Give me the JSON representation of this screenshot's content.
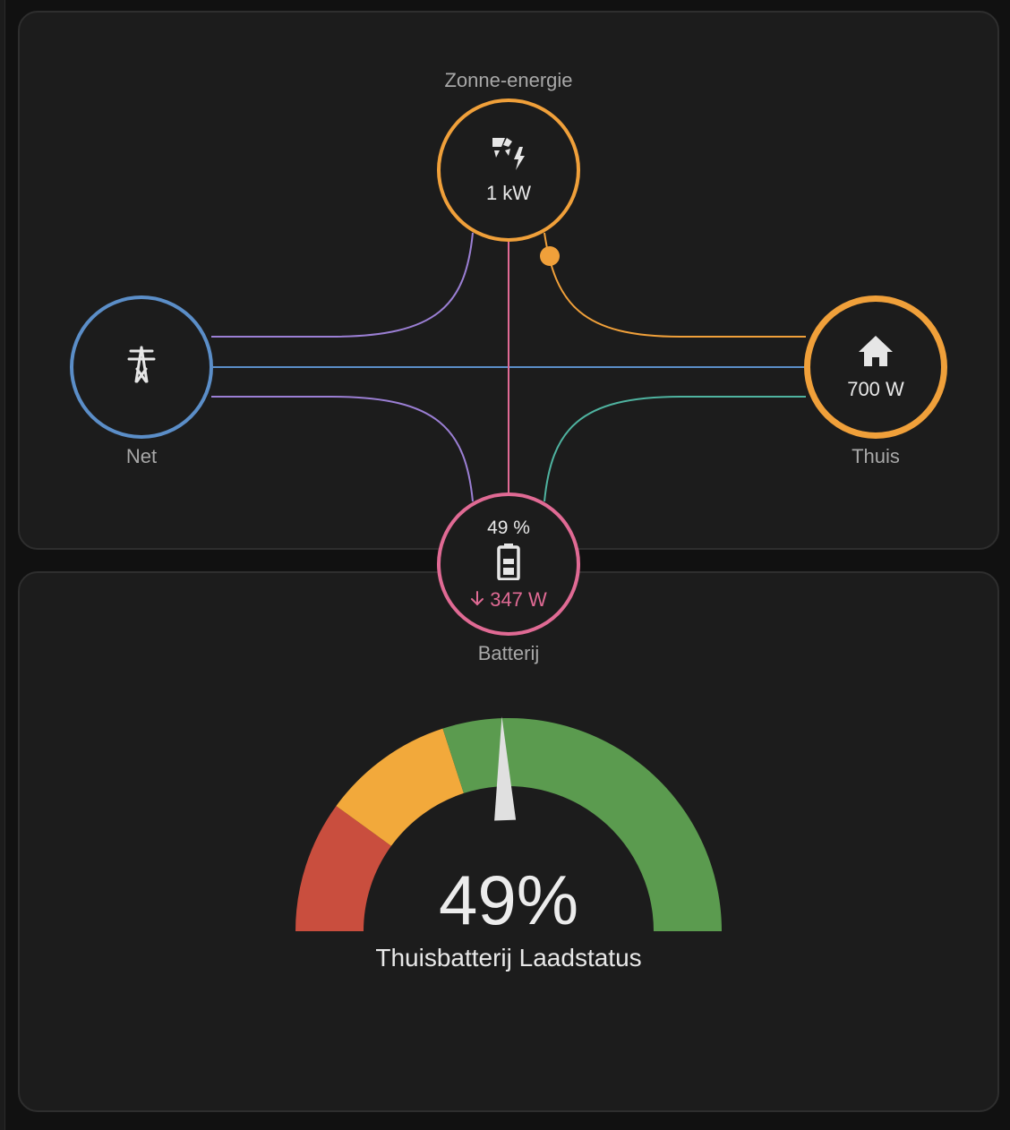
{
  "energy_flow": {
    "solar": {
      "label": "Zonne-energie",
      "value": "1 kW",
      "icon": "solar-power-icon"
    },
    "grid": {
      "label": "Net",
      "icon": "transmission-tower-icon"
    },
    "home": {
      "label": "Thuis",
      "value": "700 W",
      "icon": "home-icon"
    },
    "battery": {
      "label": "Batterij",
      "percent": "49 %",
      "power": "347 W",
      "icon": "battery-icon",
      "direction_icon": "arrow-down-icon"
    },
    "colors": {
      "solar": "#f0a03a",
      "grid": "#5b8ec8",
      "battery": "#e06a94",
      "grid_to_battery": "#9b7fd4",
      "battery_to_home": "#4fb3a0"
    }
  },
  "gauge": {
    "value_text": "49%",
    "value": 49,
    "min": 0,
    "max": 100,
    "name": "Thuisbatterij Laadstatus",
    "segments": [
      {
        "from": 0,
        "to": 20,
        "color": "#c94e3e"
      },
      {
        "from": 20,
        "to": 40,
        "color": "#f2a93b"
      },
      {
        "from": 40,
        "to": 100,
        "color": "#5b9b4f"
      }
    ],
    "needle_color": "#e0e0e0"
  }
}
